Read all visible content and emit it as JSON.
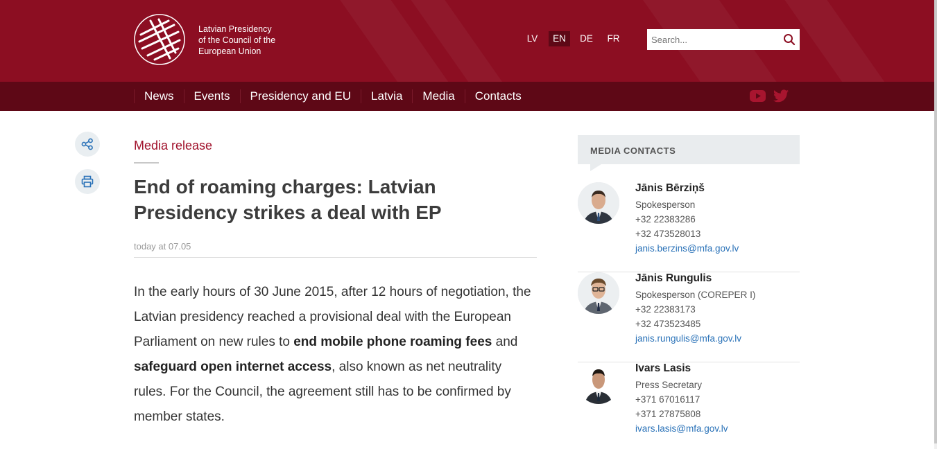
{
  "brand": {
    "line1": "Latvian Presidency",
    "line2": "of the Council of the",
    "line3": "European Union"
  },
  "languages": [
    {
      "label": "LV",
      "active": false
    },
    {
      "label": "EN",
      "active": true
    },
    {
      "label": "DE",
      "active": false
    },
    {
      "label": "FR",
      "active": false
    }
  ],
  "search": {
    "placeholder": "Search...",
    "icon": "search-icon"
  },
  "nav": {
    "items": [
      "News",
      "Events",
      "Presidency and EU",
      "Latvia",
      "Media",
      "Contacts"
    ]
  },
  "social": {
    "youtube": "youtube-icon",
    "twitter": "twitter-icon"
  },
  "tools": {
    "share": "share-icon",
    "print": "print-icon"
  },
  "article": {
    "category": "Media release",
    "title": "End of roaming charges: Latvian Presidency strikes a deal with EP",
    "date": "today at 07.05",
    "lead": {
      "part1": "In the early hours of 30 June 2015, after 12 hours of negotiation, the Latvian presidency reached a provisional deal with the European Parliament on new rules to ",
      "bold1": "end mobile phone roaming fees",
      "part2": " and ",
      "bold2": "safeguard open internet access",
      "part3": ", also known as net neutrality rules. For the Council, the agreement still has to be confirmed by member states."
    }
  },
  "media_contacts": {
    "heading": "MEDIA CONTACTS",
    "contacts": [
      {
        "name": "Jānis Bērziņš",
        "role": "Spokesperson",
        "phone1": "+32 22383286",
        "phone2": "+32 473528013",
        "email": "janis.berzins@mfa.gov.lv"
      },
      {
        "name": "Jānis Rungulis",
        "role": "Spokesperson (COREPER I)",
        "phone1": "+32 22383173",
        "phone2": "+32 473523485",
        "email": "janis.rungulis@mfa.gov.lv"
      },
      {
        "name": "Ivars Lasis",
        "role": "Press Secretary",
        "phone1": "+371 67016117",
        "phone2": "+371 27875808",
        "email": "ivars.lasis@mfa.gov.lv"
      }
    ]
  },
  "colors": {
    "brand": "#8c0e22",
    "nav": "#5e0816",
    "accent": "#a0102a",
    "link": "#2a72b8"
  }
}
